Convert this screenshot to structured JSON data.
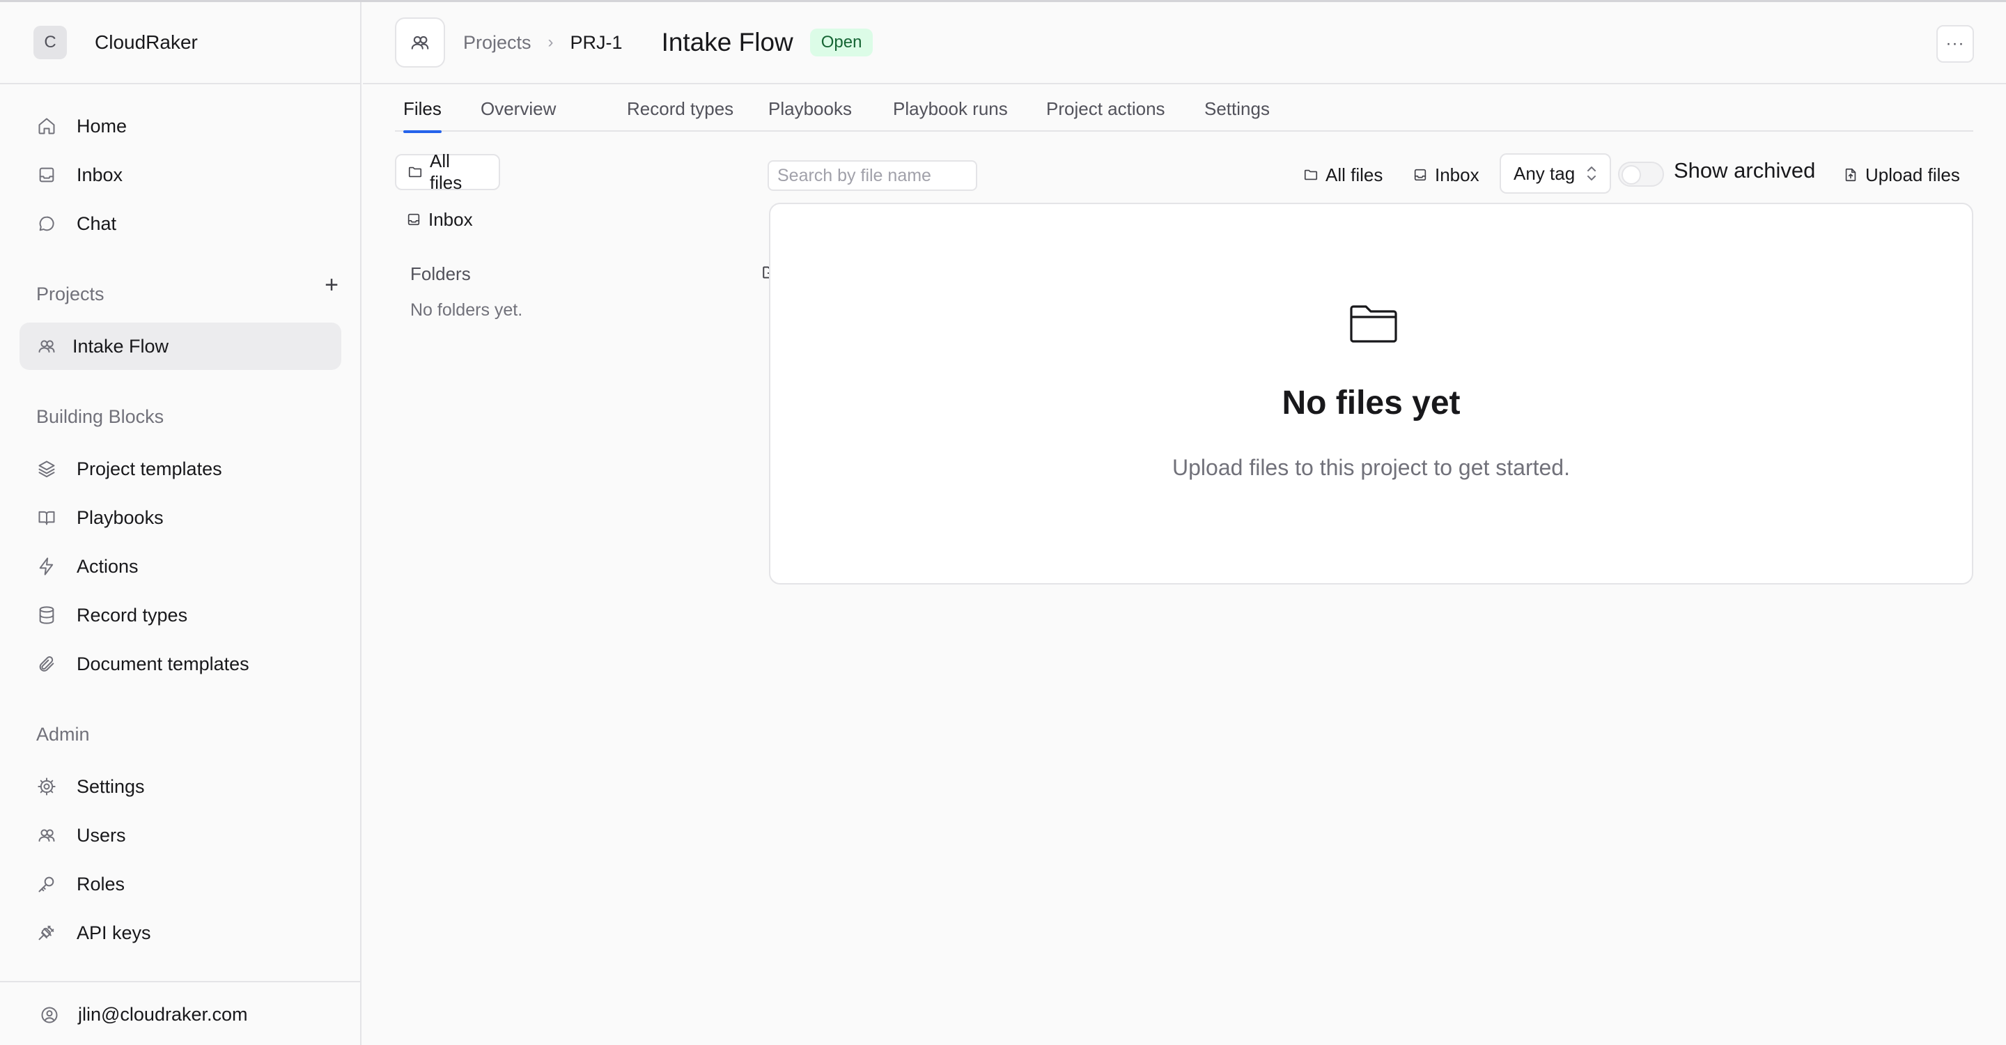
{
  "org": {
    "initial": "C",
    "name": "CloudRaker"
  },
  "nav": {
    "main": [
      {
        "label": "Home",
        "icon": "home-icon"
      },
      {
        "label": "Inbox",
        "icon": "inbox-icon"
      },
      {
        "label": "Chat",
        "icon": "chat-icon"
      }
    ],
    "projects_title": "Projects",
    "add_project_label": "+",
    "projects": [
      {
        "label": "Intake Flow",
        "icon": "users-icon",
        "active": true
      }
    ],
    "building_blocks_title": "Building Blocks",
    "building_blocks": [
      {
        "label": "Project templates",
        "icon": "layers-icon"
      },
      {
        "label": "Playbooks",
        "icon": "book-icon"
      },
      {
        "label": "Actions",
        "icon": "lightning-icon"
      },
      {
        "label": "Record types",
        "icon": "database-icon"
      },
      {
        "label": "Document templates",
        "icon": "paperclip-icon"
      }
    ],
    "admin_title": "Admin",
    "admin": [
      {
        "label": "Settings",
        "icon": "gear-icon"
      },
      {
        "label": "Users",
        "icon": "users-icon"
      },
      {
        "label": "Roles",
        "icon": "key-icon"
      },
      {
        "label": "API keys",
        "icon": "plug-icon"
      }
    ],
    "user_email": "jlin@cloudraker.com"
  },
  "header": {
    "breadcrumb_root": "Projects",
    "breadcrumb_id": "PRJ-1",
    "title": "Intake Flow",
    "status": "Open",
    "more_label": "···"
  },
  "tabs": [
    {
      "label": "Files",
      "active": true
    },
    {
      "label": "Overview"
    },
    {
      "label": "Record types"
    },
    {
      "label": "Playbooks"
    },
    {
      "label": "Playbook runs"
    },
    {
      "label": "Project actions"
    },
    {
      "label": "Settings"
    }
  ],
  "files": {
    "left": {
      "all_files": "All files",
      "inbox": "Inbox",
      "folders_title": "Folders",
      "no_folders": "No folders yet."
    },
    "toolbar": {
      "search_placeholder": "Search by file name",
      "all_files": "All files",
      "inbox": "Inbox",
      "tag_select": "Any tag",
      "show_archived": "Show archived",
      "show_archived_on": false,
      "upload": "Upload files"
    },
    "empty": {
      "title": "No files yet",
      "subtitle": "Upload files to this project to get started."
    }
  }
}
